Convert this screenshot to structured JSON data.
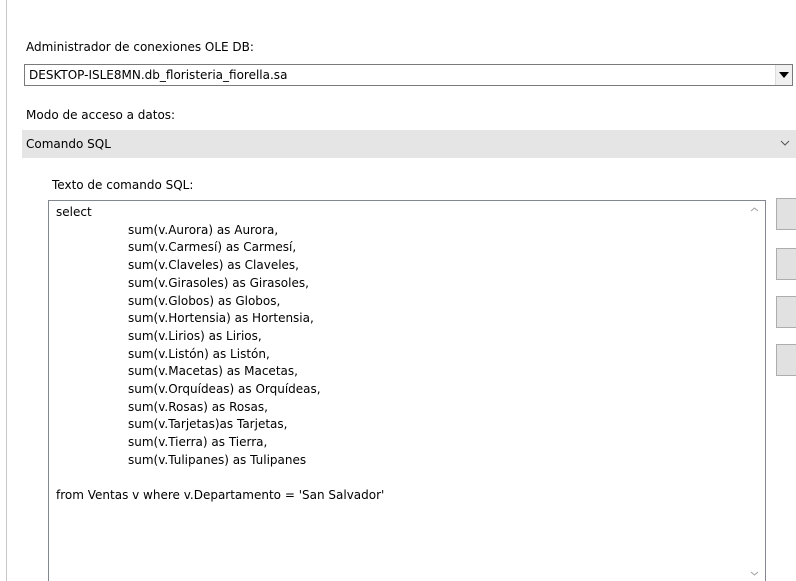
{
  "connection_manager": {
    "label": "Administrador de conexiones OLE DB:",
    "value": "DESKTOP-ISLE8MN.db_floristeria_fiorella.sa"
  },
  "data_access_mode": {
    "label": "Modo de acceso a datos:",
    "value": "Comando SQL"
  },
  "sql_command": {
    "label": "Texto de comando SQL:",
    "lines": [
      "select",
      "sum(v.Aurora) as Aurora,",
      "sum(v.Carmesí) as Carmesí,",
      "sum(v.Claveles) as Claveles,",
      "sum(v.Girasoles) as Girasoles,",
      "sum(v.Globos) as Globos,",
      "sum(v.Hortensia) as Hortensia,",
      "sum(v.Lirios) as Lirios,",
      "sum(v.Listón) as Listón,",
      "sum(v.Macetas) as Macetas,",
      "sum(v.Orquídeas) as Orquídeas,",
      "sum(v.Rosas) as Rosas,",
      "sum(v.Tarjetas)as Tarjetas,",
      "sum(v.Tierra) as Tierra,",
      "sum(v.Tulipanes) as Tulipanes",
      "",
      "from Ventas v where v.Departamento = 'San Salvador'"
    ]
  },
  "icons": {
    "dropdown": "dropdown-arrow-icon",
    "chevron": "chevron-down-icon",
    "scroll_up": "scroll-up-icon",
    "scroll_down": "scroll-down-icon"
  },
  "colors": {
    "combo_bg": "#e5e5e5",
    "button_bg": "#e1e1e1",
    "border": "#828790"
  }
}
